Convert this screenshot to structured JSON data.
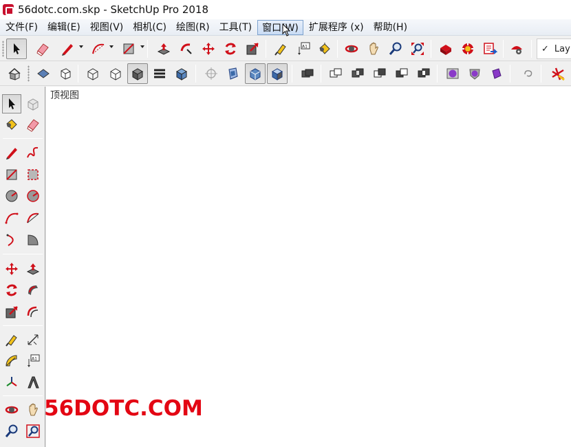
{
  "window": {
    "title": "56dotc.com.skp - SketchUp Pro 2018"
  },
  "menubar": {
    "items": [
      {
        "label": "文件(F)"
      },
      {
        "label": "编辑(E)"
      },
      {
        "label": "视图(V)"
      },
      {
        "label": "相机(C)"
      },
      {
        "label": "绘图(R)"
      },
      {
        "label": "工具(T)"
      },
      {
        "label": "窗口(W)",
        "hover": true
      },
      {
        "label": "扩展程序 (x)"
      },
      {
        "label": "帮助(H)"
      }
    ]
  },
  "layers": {
    "check": "✓",
    "label": "Lay"
  },
  "canvas": {
    "view_label": "顶视图"
  },
  "watermark": {
    "text": "56DOTC.COM"
  },
  "colors": {
    "accent_red": "#e30613",
    "menu_hover": "#c9dcf4"
  }
}
